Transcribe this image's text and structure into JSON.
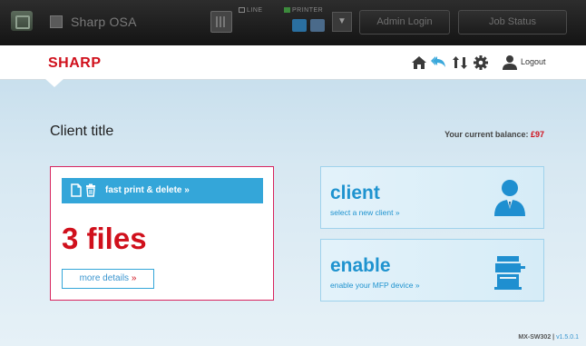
{
  "topbar": {
    "osa_label": "Sharp OSA",
    "line_label": "LINE",
    "printer_label": "PRINTER",
    "admin_login": "Admin Login",
    "job_status": "Job Status",
    "dropdown_glyph": "▼"
  },
  "header": {
    "logo": "SHARP",
    "logout_label": "Logout",
    "icons": [
      "home-icon",
      "back-icon",
      "swap-icon",
      "gear-icon",
      "user-icon"
    ]
  },
  "main": {
    "client_title": "Client title",
    "balance_label": "Your current balance:",
    "balance_amount": "£97",
    "fast_print": {
      "label": "fast print & delete »",
      "files": "3 files",
      "more_label": "more details",
      "more_arrow": "»"
    },
    "tiles": [
      {
        "title": "client",
        "subtitle": "select a new client",
        "arrow": "»",
        "icon": "person-icon"
      },
      {
        "title": "enable",
        "subtitle": "enable your MFP device",
        "arrow": "»",
        "icon": "printer-icon"
      }
    ],
    "model": "MX-SW302",
    "version": "v1.5.0.1"
  },
  "colors": {
    "brand_red": "#d0101c",
    "accent_blue": "#34a6d9",
    "tile_text_blue": "#1f93cf"
  }
}
